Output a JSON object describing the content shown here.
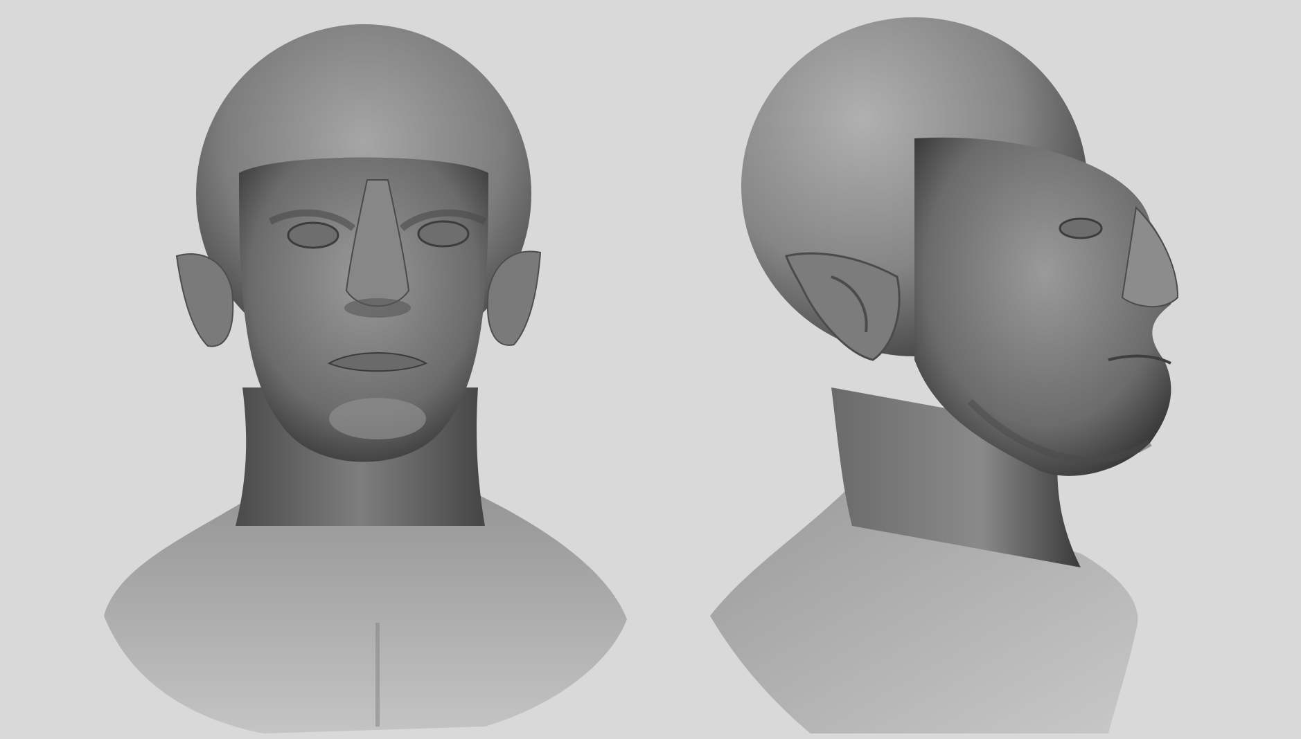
{
  "scene": {
    "background_color": "#d9d9d9",
    "material_color": "#8a8a8a",
    "views": [
      {
        "id": "front",
        "subject": "sculpted-head-bust",
        "angle": "front"
      },
      {
        "id": "side",
        "subject": "sculpted-head-bust",
        "angle": "three-quarter-right"
      }
    ]
  }
}
